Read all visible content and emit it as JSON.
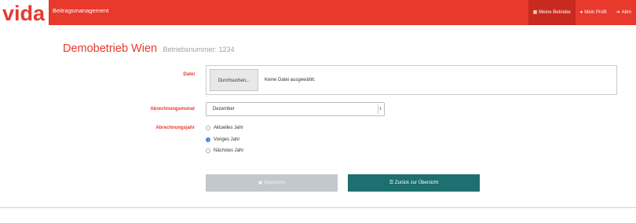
{
  "header": {
    "logo": "vida",
    "app_title": "Beitragsmanagement",
    "nav": [
      {
        "icon": "building-icon",
        "label": "Meine Betriebe",
        "active": true
      },
      {
        "icon": "user-icon",
        "label": "Mein Profil",
        "active": false
      },
      {
        "icon": "logout-icon",
        "label": "Abm",
        "active": false
      }
    ]
  },
  "company": {
    "name": "Demobetrieb Wien",
    "number_label": "Betriebsnummer: 1234"
  },
  "form": {
    "file_label": "Datei",
    "file_button": "Durchsuchen...",
    "file_status": "Keine Datei ausgewählt.",
    "month_label": "Abrechnungsmonat",
    "month_value": "Dezember",
    "year_label": "Abrechnungsjahr",
    "year_options": [
      {
        "label": "Aktuelles Jahr",
        "checked": false
      },
      {
        "label": "Voriges Jahr",
        "checked": true
      },
      {
        "label": "Nächstes Jahr",
        "checked": false
      }
    ]
  },
  "buttons": {
    "save": "Speichern",
    "save_icon": "save-icon",
    "back": "Zurück zur Übersicht",
    "back_icon": "list-icon"
  },
  "colors": {
    "brand_red": "#e8392c",
    "teal": "#1e6f6f",
    "disabled_gray": "#c3c8cc"
  }
}
